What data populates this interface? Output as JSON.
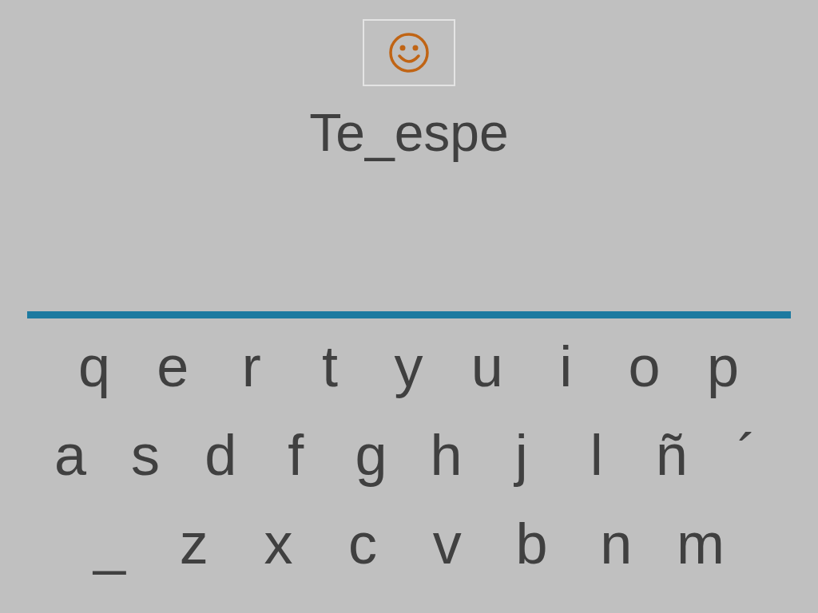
{
  "word": "Te_espe",
  "keyboard": {
    "rows": [
      [
        "q",
        "e",
        "r",
        "t",
        "y",
        "u",
        "i",
        "o",
        "p"
      ],
      [
        "a",
        "s",
        "d",
        "f",
        "g",
        "h",
        "j",
        "l",
        "ñ",
        "´"
      ],
      [
        "_",
        "z",
        "x",
        "c",
        "v",
        "b",
        "n",
        "m"
      ]
    ]
  }
}
